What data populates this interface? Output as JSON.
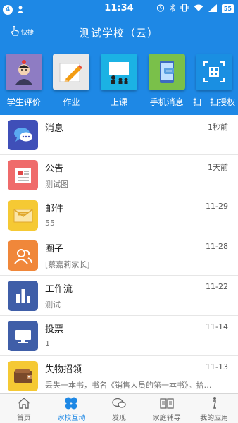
{
  "status_bar": {
    "notif_count": "4",
    "time": "11:34",
    "battery": "55"
  },
  "header": {
    "quick_label": "快捷",
    "title": "测试学校（云）"
  },
  "shortcuts": [
    {
      "label": "学生评价",
      "icon": "student-evaluation-icon",
      "color": "#8e7cc3"
    },
    {
      "label": "作业",
      "icon": "homework-pencil-icon",
      "color": "#e8e8e8"
    },
    {
      "label": "上课",
      "icon": "class-teacher-icon",
      "color": "#1bb2e4"
    },
    {
      "label": "手机消息",
      "icon": "phone-message-icon",
      "color": "#7ac04a"
    },
    {
      "label": "扫一扫授权",
      "icon": "qr-scan-icon",
      "color": "#1a8fe2"
    }
  ],
  "list": [
    {
      "name": "消息",
      "sub": "",
      "time": "1秒前",
      "icon": "chat-bubble-icon",
      "color": "#3f4fb8"
    },
    {
      "name": "公告",
      "sub": "测试图",
      "time": "1天前",
      "icon": "announcement-icon",
      "color": "#ef6b6b"
    },
    {
      "name": "邮件",
      "sub": "55",
      "time": "11-29",
      "icon": "mail-icon",
      "color": "#f5c934"
    },
    {
      "name": "圈子",
      "sub": "[蔡嘉莉家长]",
      "time": "11-28",
      "icon": "circle-people-icon",
      "color": "#f0873a"
    },
    {
      "name": "工作流",
      "sub": "测试",
      "time": "11-22",
      "icon": "workflow-chart-icon",
      "color": "#3f5ea8"
    },
    {
      "name": "投票",
      "sub": "1",
      "time": "11-14",
      "icon": "vote-monitor-icon",
      "color": "#3f5ea8"
    },
    {
      "name": "失物招领",
      "sub": "丢失一本书，书名《销售人员的第一本书》。拾…",
      "time": "11-13",
      "icon": "lost-found-wallet-icon",
      "color": "#f5c934"
    }
  ],
  "tabs": [
    {
      "label": "首页",
      "icon": "home-icon",
      "active": false
    },
    {
      "label": "家校互动",
      "icon": "clover-icon",
      "active": true
    },
    {
      "label": "发现",
      "icon": "discover-bubble-icon",
      "active": false
    },
    {
      "label": "家庭辅导",
      "icon": "book-icon",
      "active": false
    },
    {
      "label": "我的应用",
      "icon": "info-icon",
      "active": false
    }
  ],
  "colors": {
    "primary": "#1e88e5",
    "tab_inactive": "#666666"
  }
}
